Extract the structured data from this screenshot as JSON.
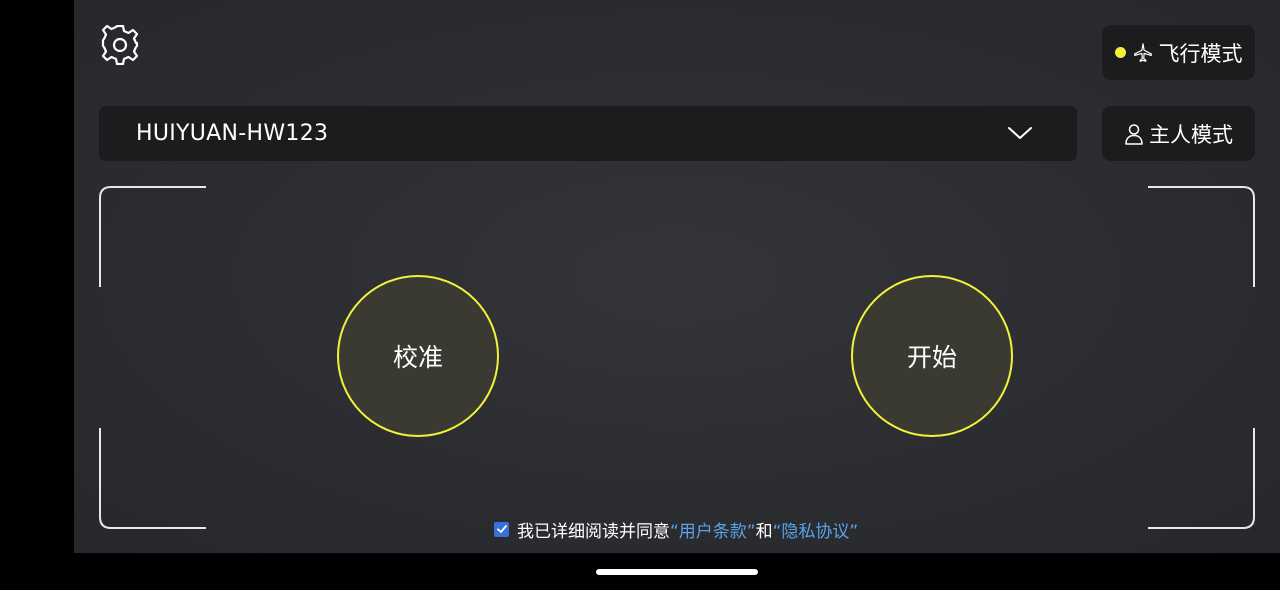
{
  "header": {
    "settings_icon": "gear-icon",
    "flight_mode": {
      "icon": "airplane-icon",
      "label": "飞行模式",
      "indicator_color": "#f2f23a"
    },
    "owner_mode": {
      "icon": "person-icon",
      "label": "主人模式"
    }
  },
  "device_select": {
    "value": "HUIYUAN-HW123",
    "icon": "chevron-down-icon"
  },
  "controls": {
    "calibrate_label": "校准",
    "start_label": "开始",
    "accent_color": "#f2f23a"
  },
  "agreement": {
    "checked": true,
    "prefix": "我已详细阅读并同意",
    "terms_link": "“用户条款”",
    "conjunction": "和",
    "privacy_link": "“隐私协议”",
    "link_color": "#5aa3e8"
  }
}
